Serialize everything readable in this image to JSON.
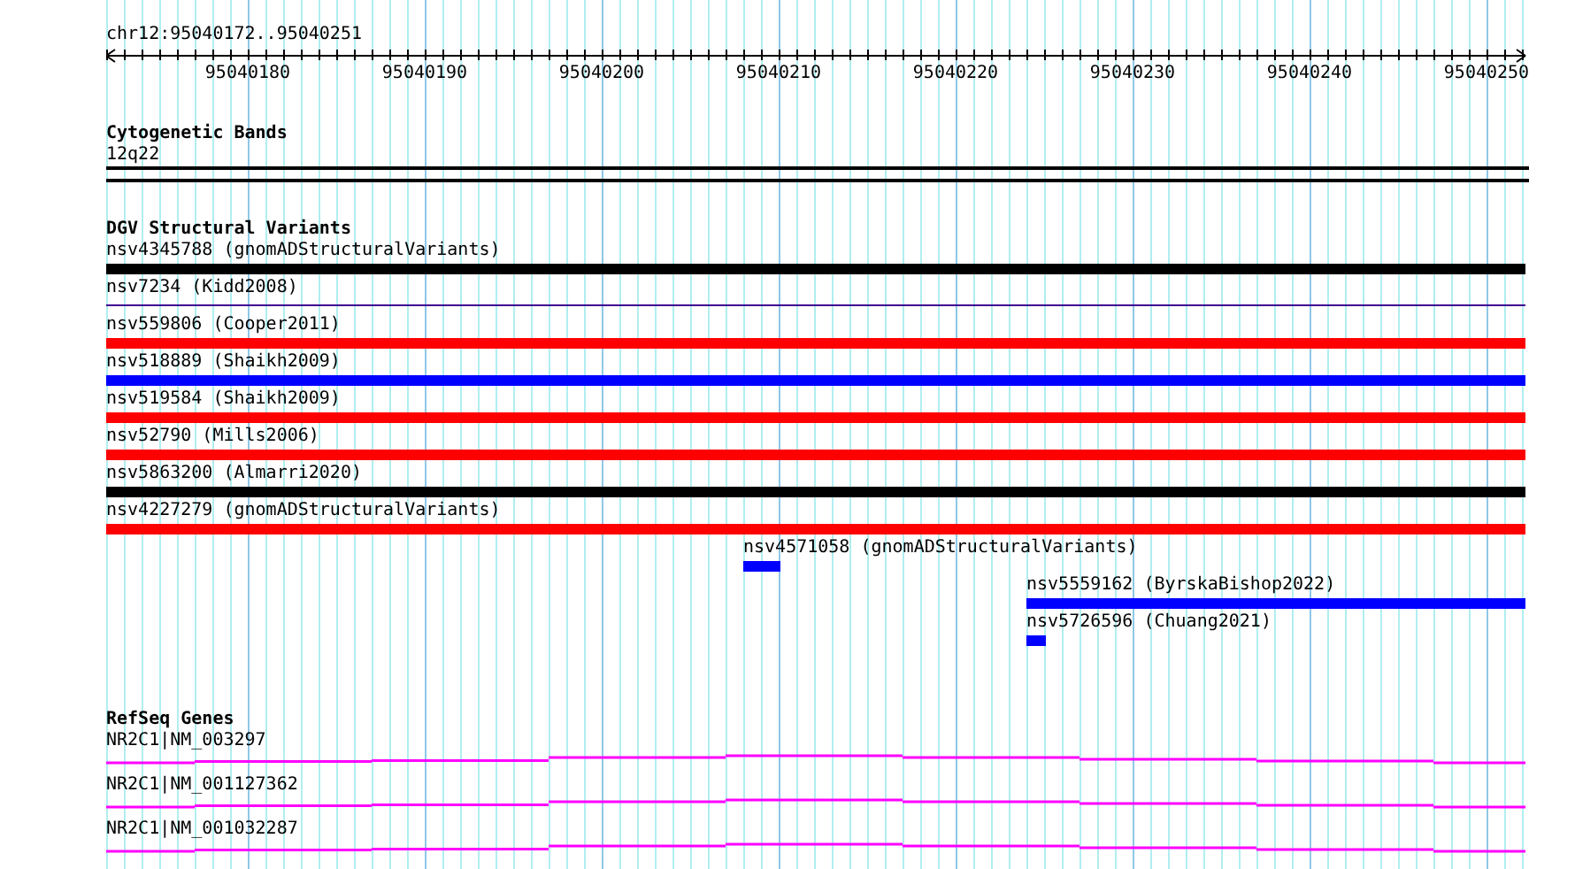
{
  "ruler": {
    "label": "chr12:95040172..95040251",
    "ticks": [
      "95040180",
      "95040190",
      "95040200",
      "95040210",
      "95040220",
      "95040230",
      "95040240",
      "95040250"
    ]
  },
  "cytogenetic_bands": {
    "title": "Cytogenetic Bands",
    "band": "12q22"
  },
  "dgv_variants": {
    "title": "DGV Structural Variants",
    "items": [
      {
        "label": "nsv4345788 (gnomADStructuralVariants)",
        "color": "#000000",
        "kind": "bar"
      },
      {
        "label": "nsv7234 (Kidd2008)",
        "color": "#400090",
        "kind": "line"
      },
      {
        "label": "nsv559806 (Cooper2011)",
        "color": "#ff0000",
        "kind": "bar"
      },
      {
        "label": "nsv518889 (Shaikh2009)",
        "color": "#0000ff",
        "kind": "bar"
      },
      {
        "label": "nsv519584 (Shaikh2009)",
        "color": "#ff0000",
        "kind": "bar"
      },
      {
        "label": "nsv52790 (Mills2006)",
        "color": "#ff0000",
        "kind": "bar"
      },
      {
        "label": "nsv5863200 (Almarri2020)",
        "color": "#000000",
        "kind": "bar"
      },
      {
        "label": "nsv4227279 (gnomADStructuralVariants)",
        "color": "#ff0000",
        "kind": "bar"
      },
      {
        "label": "nsv4571058 (gnomADStructuralVariants)",
        "color": "#0000ff",
        "kind": "bar"
      },
      {
        "label": "nsv5559162 (ByrskaBishop2022)",
        "color": "#0000ff",
        "kind": "bar"
      },
      {
        "label": "nsv5726596 (Chuang2021)",
        "color": "#0000ff",
        "kind": "bar"
      }
    ]
  },
  "refseq_genes": {
    "title": "RefSeq Genes",
    "items": [
      {
        "label": "NR2C1|NM_003297"
      },
      {
        "label": "NR2C1|NM_001127362"
      },
      {
        "label": "NR2C1|NM_001032287"
      }
    ]
  }
}
